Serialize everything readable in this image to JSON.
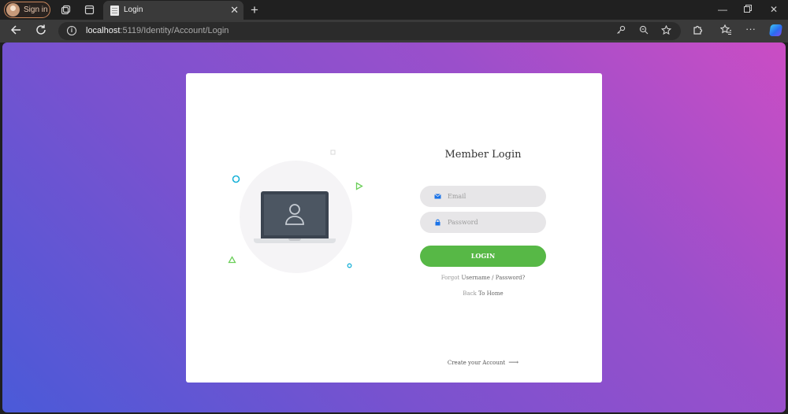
{
  "browser": {
    "profile_label": "Sign in",
    "tab_title": "Login",
    "url_host": "localhost",
    "url_path": ":5119/Identity/Account/Login"
  },
  "form": {
    "title": "Member Login",
    "email_placeholder": "Email",
    "password_placeholder": "Password",
    "login_label": "LOGIN",
    "forgot_prefix": "Forgot",
    "forgot_link": "Username / Password?",
    "back_prefix": "Back",
    "back_link": "To Home",
    "create_account": "Create your Account",
    "create_arrow": "⟶"
  },
  "colors": {
    "accent_green": "#57b846",
    "bg_gradient_start": "#4a5ad8",
    "bg_gradient_end": "#cb4dc4"
  },
  "icons": [
    "tab-actions-icon",
    "vertical-tabs-icon",
    "page-icon",
    "back-icon",
    "refresh-icon",
    "info-icon",
    "key-icon",
    "zoom-icon",
    "favorite-icon",
    "extensions-icon",
    "favorites-icon",
    "more-icon",
    "copilot-icon",
    "envelope-icon",
    "lock-icon",
    "user-icon"
  ]
}
